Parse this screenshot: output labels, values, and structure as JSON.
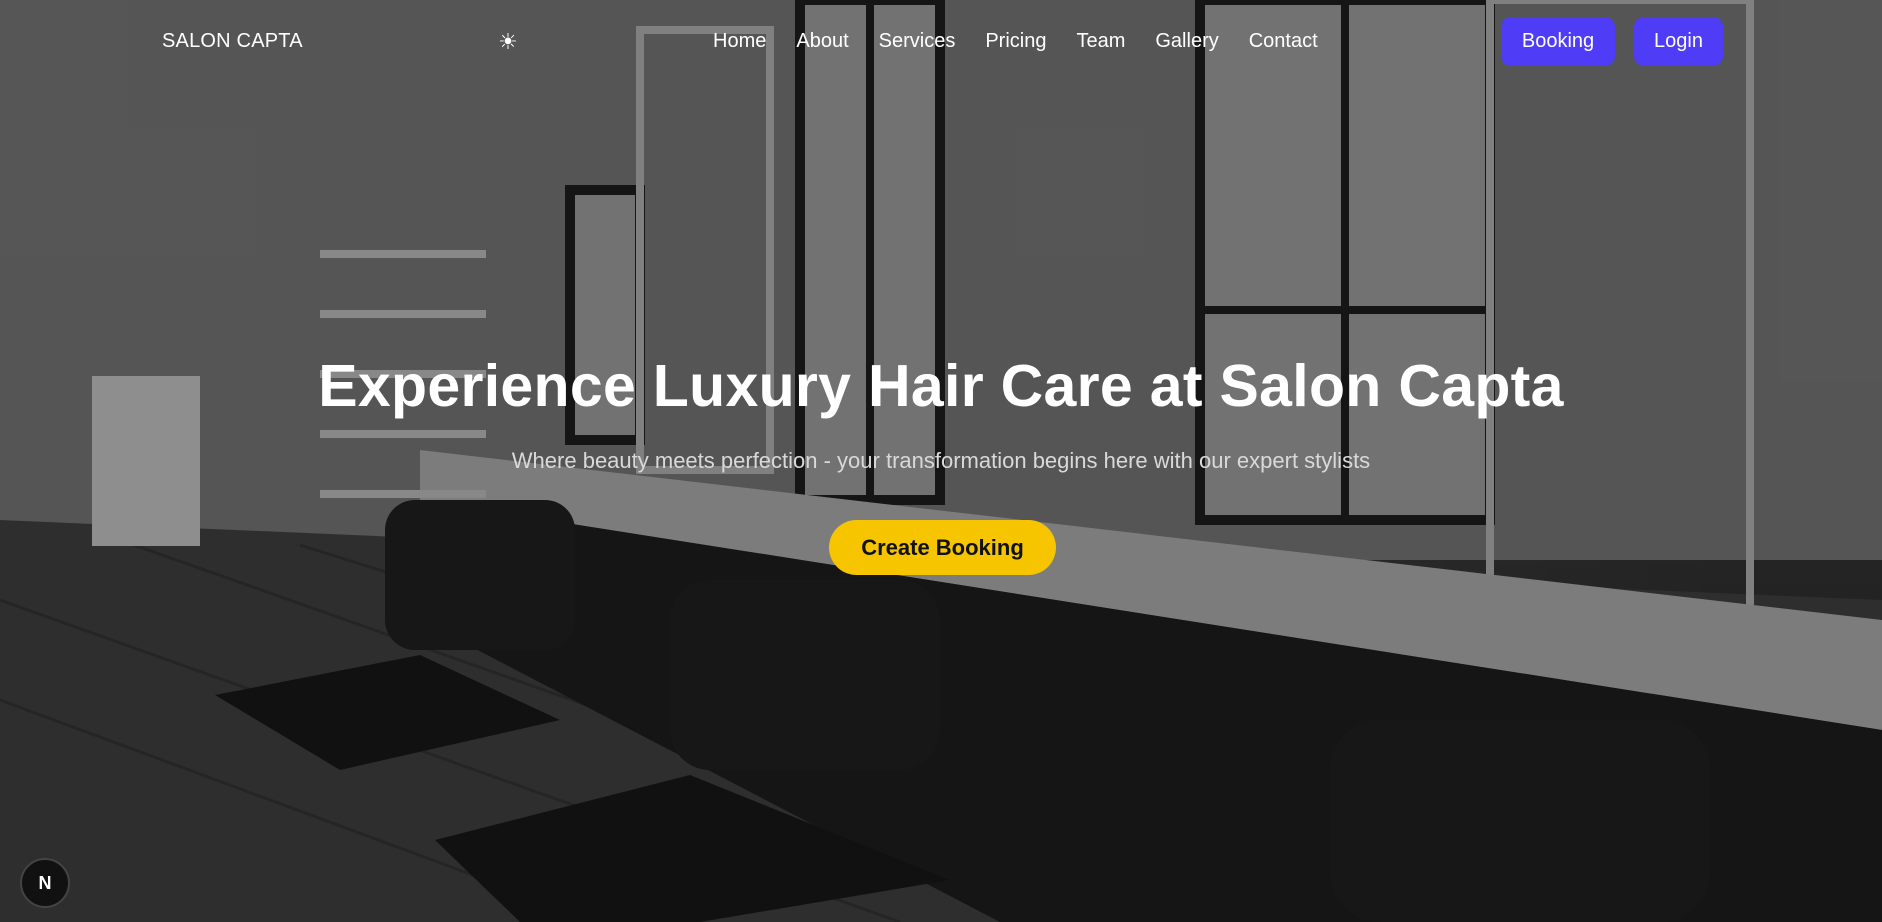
{
  "nav": {
    "brand": "SALON CAPTA",
    "theme_icon": "sun-icon",
    "theme_glyph": "☀",
    "links": [
      "Home",
      "About",
      "Services",
      "Pricing",
      "Team",
      "Gallery",
      "Contact"
    ],
    "booking_label": "Booking",
    "login_label": "Login"
  },
  "hero": {
    "title": "Experience Luxury Hair Care at Salon Capta",
    "subtitle": "Where beauty meets perfection - your transformation begins here with our expert stylists",
    "cta_label": "Create Booking",
    "background": "grayscale-salon-interior-photo"
  },
  "dev_badge": {
    "label": "N",
    "icon": "nextjs-icon"
  },
  "colors": {
    "accent": "#4f3cf7",
    "cta": "#f7c500",
    "text": "#ffffff"
  }
}
